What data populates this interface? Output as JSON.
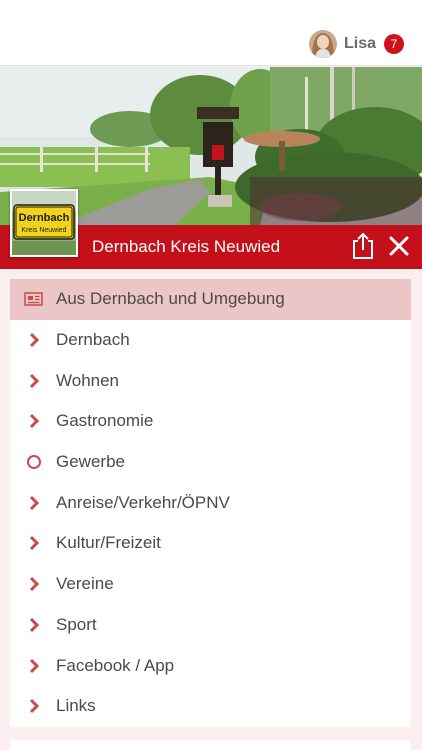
{
  "header": {
    "user_name": "Lisa",
    "notification_count": "7"
  },
  "place": {
    "title": "Dernbach Kreis Neuwied",
    "sign_line1": "Dernbach",
    "sign_line2": "Kreis Neuwied"
  },
  "menu": {
    "items": [
      {
        "label": "Aus Dernbach und Umgebung",
        "icon": "newspaper-icon"
      },
      {
        "label": "Dernbach",
        "icon": "chevron-right-icon"
      },
      {
        "label": "Wohnen",
        "icon": "chevron-right-icon"
      },
      {
        "label": "Gastronomie",
        "icon": "chevron-right-icon"
      },
      {
        "label": "Gewerbe",
        "icon": "circle-icon"
      },
      {
        "label": "Anreise/Verkehr/ÖPNV",
        "icon": "chevron-right-icon"
      },
      {
        "label": "Kultur/Freizeit",
        "icon": "chevron-right-icon"
      },
      {
        "label": "Vereine",
        "icon": "chevron-right-icon"
      },
      {
        "label": "Sport",
        "icon": "chevron-right-icon"
      },
      {
        "label": "Facebook / App",
        "icon": "chevron-right-icon"
      },
      {
        "label": "Links",
        "icon": "chevron-right-icon"
      }
    ]
  },
  "colors": {
    "brand_red": "#c4101b",
    "badge_red": "#d0121b",
    "active_row": "#ecc6c6",
    "page_background": "#fbeeee"
  }
}
